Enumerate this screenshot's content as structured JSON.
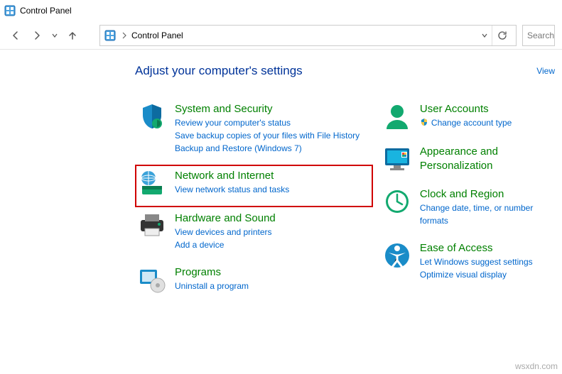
{
  "window": {
    "title": "Control Panel"
  },
  "breadcrumb": {
    "crumb1": "Control Panel"
  },
  "search": {
    "placeholder": "Search"
  },
  "heading": "Adjust your computer's settings",
  "view_label": "View",
  "categories": {
    "system_security": {
      "title": "System and Security",
      "links": [
        "Review your computer's status",
        "Save backup copies of your files with File History",
        "Backup and Restore (Windows 7)"
      ]
    },
    "network": {
      "title": "Network and Internet",
      "links": [
        "View network status and tasks"
      ]
    },
    "hardware": {
      "title": "Hardware and Sound",
      "links": [
        "View devices and printers",
        "Add a device"
      ]
    },
    "programs": {
      "title": "Programs",
      "links": [
        "Uninstall a program"
      ]
    },
    "user_accounts": {
      "title": "User Accounts",
      "links": [
        "Change account type"
      ]
    },
    "appearance": {
      "title": "Appearance and Personalization",
      "links": []
    },
    "clock": {
      "title": "Clock and Region",
      "links": [
        "Change date, time, or number formats"
      ]
    },
    "ease": {
      "title": "Ease of Access",
      "links": [
        "Let Windows suggest settings",
        "Optimize visual display"
      ]
    }
  },
  "watermark": "wsxdn.com"
}
